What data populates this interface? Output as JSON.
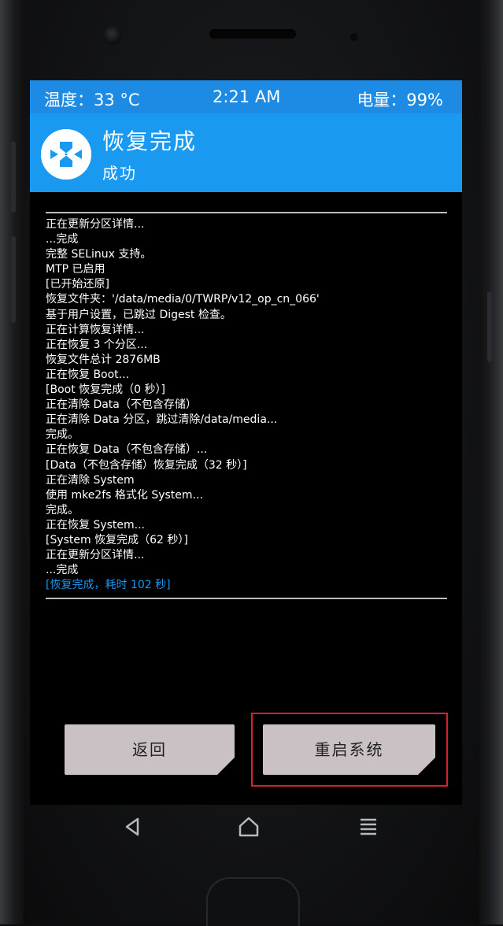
{
  "status_bar": {
    "temperature": "温度：33 °C",
    "time": "2:21 AM",
    "battery": "电量：99%"
  },
  "header": {
    "logo_icon": "twrp-logo-icon",
    "title": "恢复完成",
    "subtitle": "成功"
  },
  "log_lines": [
    "正在更新分区详情...",
    "...完成",
    "完整 SELinux 支持。",
    "MTP 已启用",
    "[已开始还原]",
    "恢复文件夹：'/data/media/0/TWRP/v12_op_cn_066'",
    "基于用户设置，已跳过 Digest 检查。",
    "正在计算恢复详情...",
    "正在恢复 3 个分区...",
    "恢复文件总计 2876MB",
    "正在恢复 Boot...",
    "[Boot 恢复完成（0 秒）]",
    "正在清除 Data（不包含存储）",
    "正在清除 Data 分区，跳过清除/data/media...",
    "完成。",
    "正在恢复 Data（不包含存储）...",
    "[Data（不包含存储）恢复完成（32 秒）]",
    "正在清除 System",
    "使用 mke2fs 格式化 System...",
    "完成。",
    "正在恢复 System...",
    "[System 恢复完成（62 秒）]",
    "正在更新分区详情...",
    "...完成"
  ],
  "log_final": "[恢复完成，耗时 102 秒]",
  "buttons": {
    "back": "返回",
    "reboot": "重启系统"
  },
  "nav": {
    "back_icon": "triangle-back-icon",
    "home_icon": "home-icon",
    "menu_icon": "menu-icon"
  },
  "colors": {
    "status_bar": "#1d8be3",
    "header": "#1a99f1",
    "button": "#c9c1c3",
    "highlight": "#d8222a"
  }
}
